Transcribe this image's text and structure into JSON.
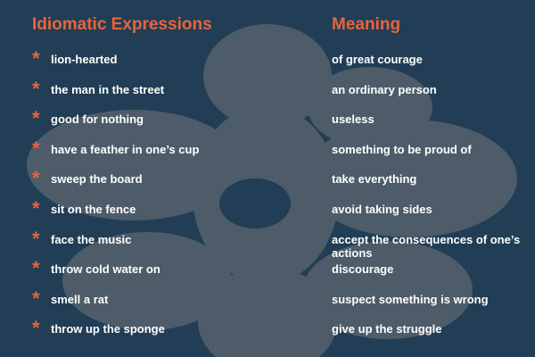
{
  "colors": {
    "background": "#213e56",
    "shape": "#4d5c68",
    "accent": "#e8643a",
    "text": "#ffffff"
  },
  "header": {
    "left_title": "Idiomatic Expressions",
    "right_title": "Meaning"
  },
  "rows": [
    {
      "bullet": "*",
      "idiom": "lion-hearted",
      "meaning": "of great courage"
    },
    {
      "bullet": "*",
      "idiom": "the man in the street",
      "meaning": "an ordinary person"
    },
    {
      "bullet": "*",
      "idiom": "good for nothing",
      "meaning": "useless"
    },
    {
      "bullet": "*",
      "idiom": "have a feather in one’s cup",
      "meaning": "something to be proud of"
    },
    {
      "bullet": "*",
      "idiom": "sweep the board",
      "meaning": "take everything"
    },
    {
      "bullet": "*",
      "idiom": "sit on the fence",
      "meaning": "avoid taking sides"
    },
    {
      "bullet": "*",
      "idiom": "face the music",
      "meaning": "accept the consequences of one’s actions"
    },
    {
      "bullet": "*",
      "idiom": "throw cold water on",
      "meaning": "discourage"
    },
    {
      "bullet": "*",
      "idiom": "smell a rat",
      "meaning": "suspect something is wrong"
    },
    {
      "bullet": "*",
      "idiom": "throw up the sponge",
      "meaning": "give up the struggle"
    }
  ]
}
